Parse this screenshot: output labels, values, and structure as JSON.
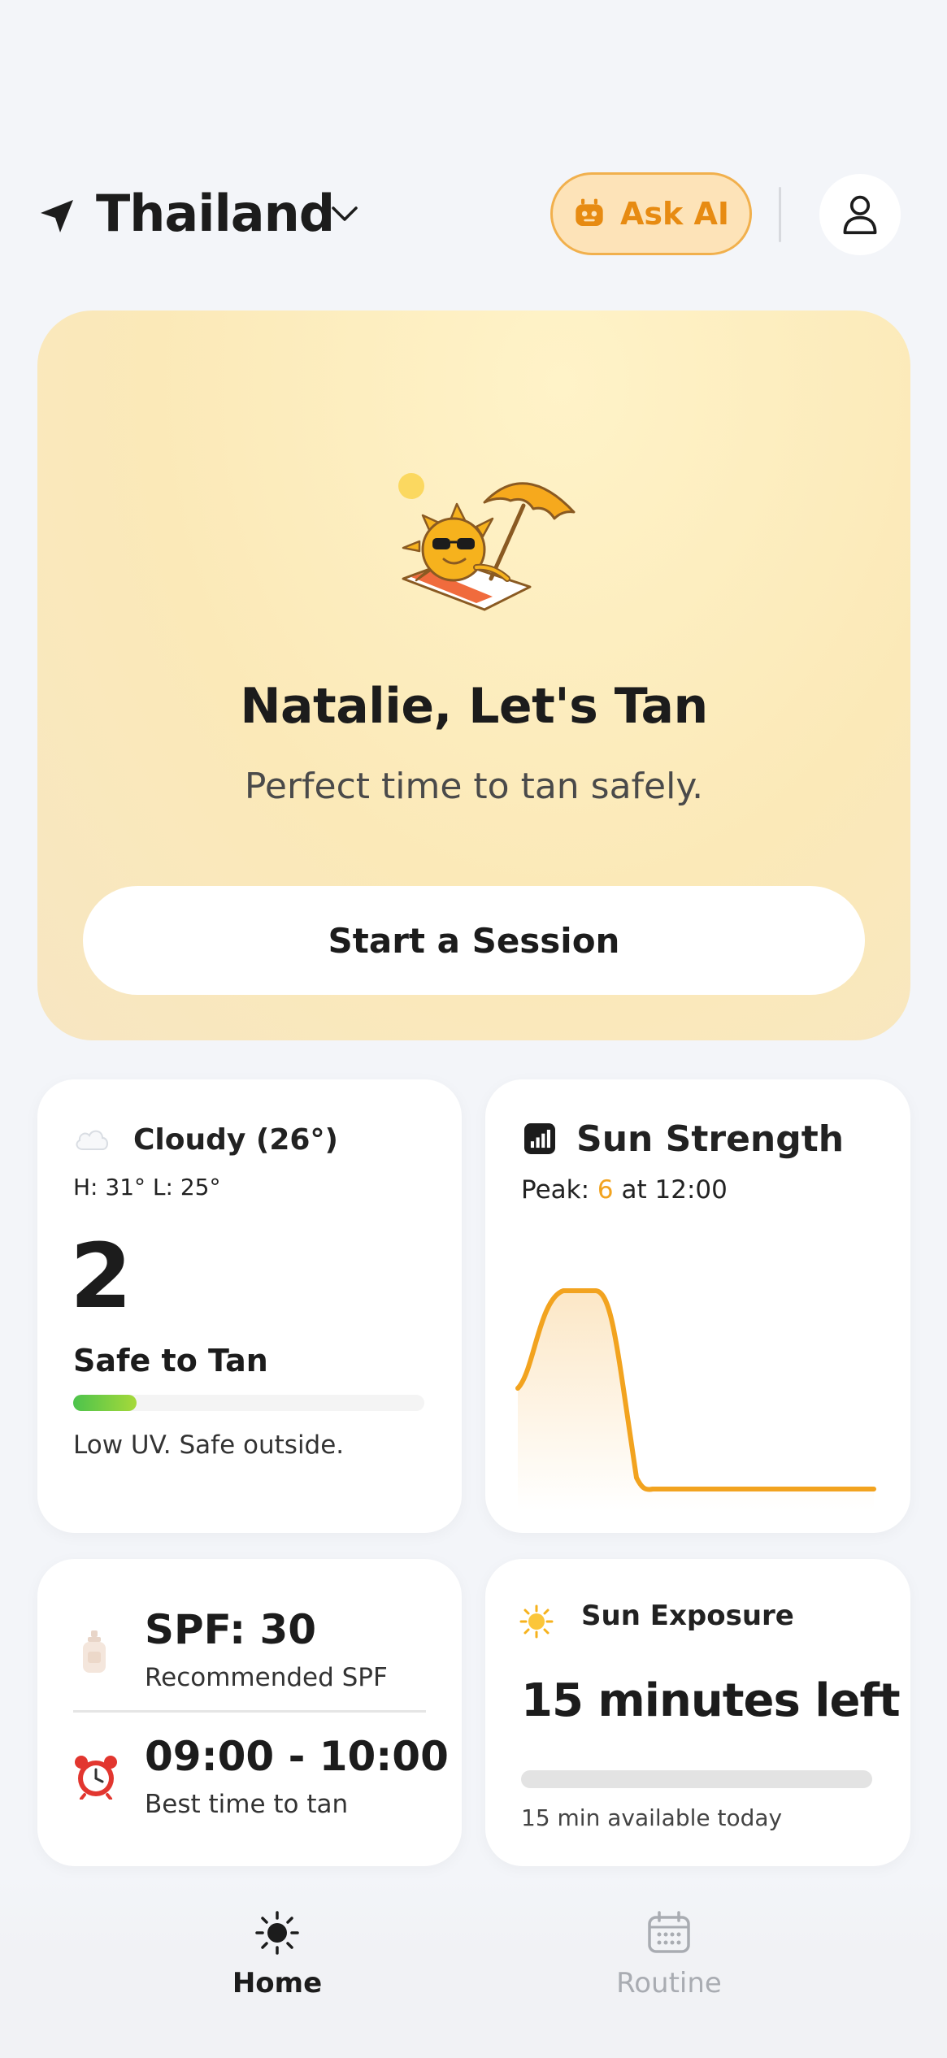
{
  "header": {
    "location": "Thailand",
    "ask_ai_label": "Ask AI"
  },
  "hero": {
    "title": "Natalie, Let's Tan",
    "subtitle": "Perfect time to tan safely.",
    "cta_label": "Start a Session"
  },
  "weather": {
    "condition": "Cloudy (26°)",
    "high_low": "H: 31°  L: 25°",
    "uv_index": "2",
    "status": "Safe to Tan",
    "uv_level_fraction": 0.18,
    "description": "Low UV. Safe outside."
  },
  "sun_strength": {
    "title": "Sun Strength",
    "peak_prefix": "Peak: ",
    "peak_value": "6",
    "peak_suffix": " at 12:00"
  },
  "spf": {
    "value": "SPF: 30",
    "label": "Recommended SPF",
    "best_time": "09:00 - 10:00",
    "best_time_label": "Best time to tan"
  },
  "exposure": {
    "title": "Sun Exposure",
    "left": "15 minutes left",
    "used_fraction": 0,
    "available": "15 min available today"
  },
  "tabs": [
    {
      "label": "Home",
      "active": true
    },
    {
      "label": "Routine",
      "active": false
    }
  ],
  "colors": {
    "accent": "#f2a31f",
    "ask_ai_bg": "#fde3b8",
    "ask_ai_text": "#e78b12",
    "safe_green": "#4cc34c"
  }
}
